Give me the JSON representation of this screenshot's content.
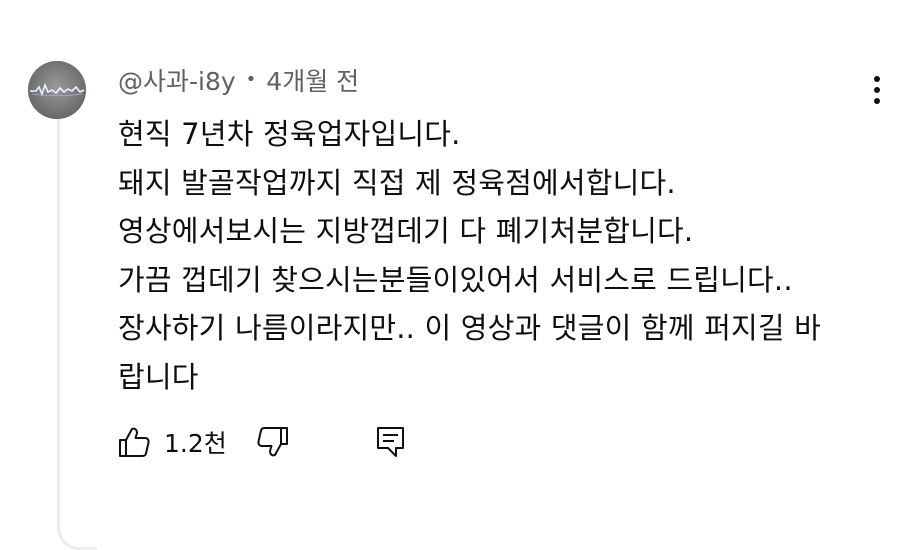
{
  "comment": {
    "author": "@사과-i8y",
    "separator": "•",
    "time": "4개월 전",
    "lines": [
      "현직 7년차 정육업자입니다.",
      "돼지 발골작업까지 직접 제 정육점에서합니다.",
      "영상에서보시는 지방껍데기 다 폐기처분합니다.",
      "가끔 껍데기 찾으시는분들이있어서 서비스로 드립니다..",
      "장사하기 나름이라지만.. 이 영상과 댓글이 함께 퍼지길 바",
      "랍니다"
    ],
    "like_count": "1.2천"
  },
  "icons": {
    "avatar": "avatar-image",
    "more": "more-vertical-icon",
    "like": "thumbs-up-icon",
    "dislike": "thumbs-down-icon",
    "reply": "reply-comment-icon"
  },
  "colors": {
    "text_primary": "#0f0f0f",
    "text_secondary": "#606060",
    "thread_line": "#ededed"
  }
}
